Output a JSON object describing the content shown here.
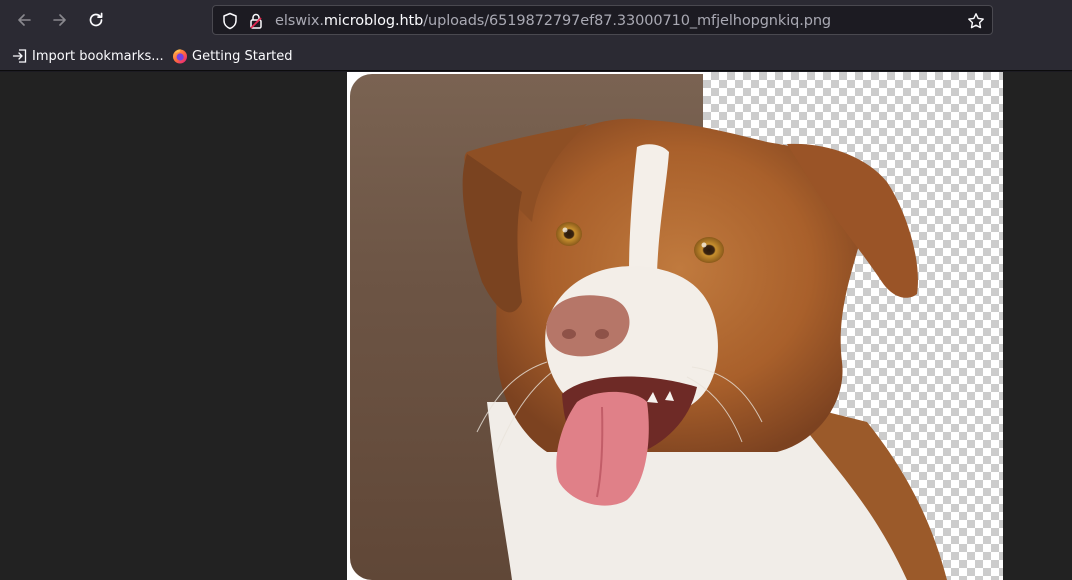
{
  "browser": {
    "url_prefix": "elswix.",
    "url_domain": "microblog.htb",
    "url_path": "/uploads/6519872797ef87.33000710_mfjelhopgnkiq.png"
  },
  "bookmarks": [
    {
      "label": "Import bookmarks..."
    },
    {
      "label": "Getting Started"
    }
  ],
  "icons": {
    "back": "arrow-left-icon",
    "forward": "arrow-right-icon",
    "reload": "reload-icon",
    "tracking": "shield-icon",
    "security": "lock-warning-icon",
    "bookmark_star": "star-icon",
    "import": "import-icon",
    "firefox": "firefox-icon"
  },
  "image": {
    "subject": "dog with partially removed background"
  }
}
